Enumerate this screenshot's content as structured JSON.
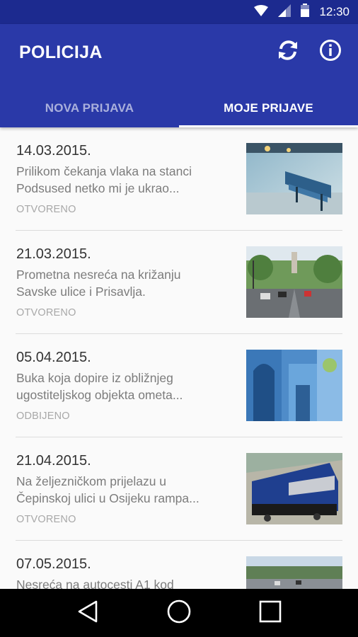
{
  "status_bar": {
    "time": "12:30"
  },
  "app": {
    "title": "POLICIJA",
    "actions": [
      {
        "name": "refresh-icon"
      },
      {
        "name": "info-icon"
      }
    ]
  },
  "tabs": [
    {
      "label": "NOVA PRIJAVA",
      "active": false
    },
    {
      "label": "MOJE PRIJAVE",
      "active": true
    }
  ],
  "reports": [
    {
      "date": "14.03.2015.",
      "desc_line1": "Prilikom čekanja vlaka na stanci",
      "desc_line2": "Podsused netko mi je ukrao...",
      "status": "OTVORENO"
    },
    {
      "date": "21.03.2015.",
      "desc_line1": "Prometna nesreća na križanju",
      "desc_line2": "Savske ulice i Prisavlja.",
      "status": "OTVORENO"
    },
    {
      "date": "05.04.2015.",
      "desc_line1": "Buka koja dopire iz obližnjeg",
      "desc_line2": "ugostiteljskog objekta ometa...",
      "status": "ODBIJENO"
    },
    {
      "date": "21.04.2015.",
      "desc_line1": "Na željezničkom prijelazu u",
      "desc_line2": "Čepinskoj ulici u Osijeku rampa...",
      "status": "OTVORENO"
    },
    {
      "date": "07.05.2015.",
      "desc_line1": "Nesreća na autocesti A1 kod",
      "desc_line2": "",
      "status": ""
    }
  ],
  "colors": {
    "primary": "#2a39a8",
    "primary_dark": "#1c2a8f"
  }
}
